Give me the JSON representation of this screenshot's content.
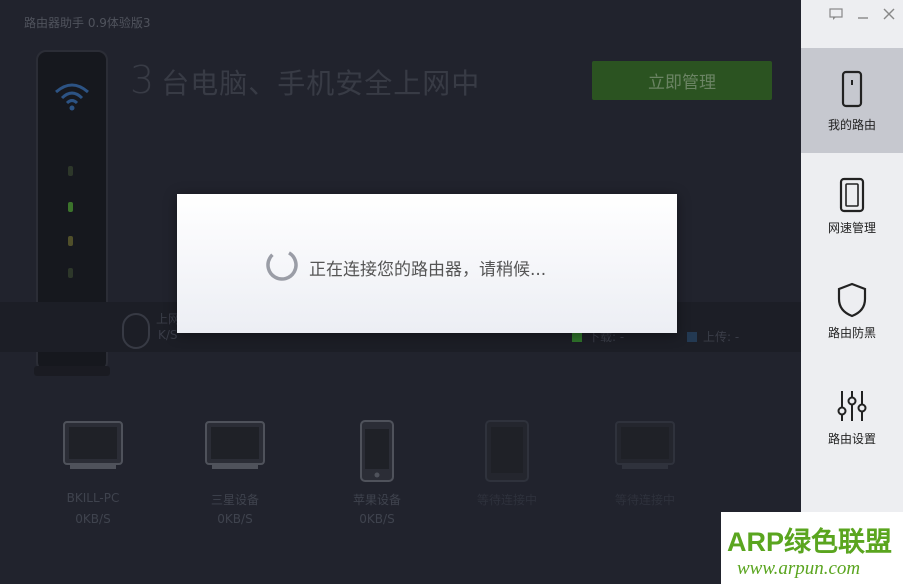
{
  "window": {
    "title": "路由器助手 0.9体验版3"
  },
  "header": {
    "count": "3",
    "headline": "台电脑、手机安全上网中",
    "manage_button": "立即管理"
  },
  "speed": {
    "upload_label": "上网",
    "unit": "K/S",
    "download_label": "下载: -",
    "upload_legend": "上传: -",
    "download_color": "#3f9a3a",
    "upload_color": "#2f4c6e"
  },
  "devices": [
    {
      "name": "BKILL-PC",
      "speed": "0KB/S",
      "icon": "monitor-icon"
    },
    {
      "name": "三星设备",
      "speed": "0KB/S",
      "icon": "monitor-icon"
    },
    {
      "name": "苹果设备",
      "speed": "0KB/S",
      "icon": "phone-icon"
    },
    {
      "name": "等待连接中",
      "speed": "",
      "icon": "tablet-icon"
    },
    {
      "name": "等待连接中",
      "speed": "",
      "icon": "monitor-icon"
    }
  ],
  "sidebar": {
    "controls": [
      "feedback-icon",
      "minimize-icon",
      "close-icon"
    ],
    "items": [
      {
        "label": "我的路由",
        "icon": "router-icon",
        "active": true
      },
      {
        "label": "网速管理",
        "icon": "speed-icon",
        "active": false
      },
      {
        "label": "路由防黑",
        "icon": "shield-icon",
        "active": false
      },
      {
        "label": "路由设置",
        "icon": "sliders-icon",
        "active": false
      }
    ]
  },
  "modal": {
    "message": "正在连接您的路由器，请稍候..."
  },
  "watermark": {
    "brand": "ARP绿色联盟",
    "site": "www.arpun.com"
  }
}
